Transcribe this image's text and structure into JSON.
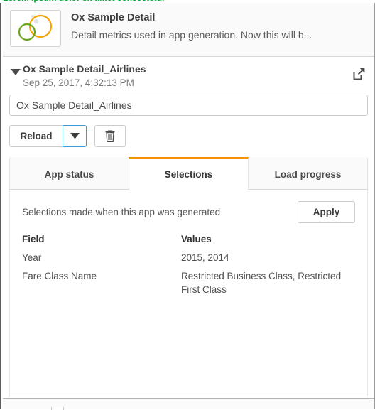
{
  "top_clipped_text": "Lorem ipsum dolor sit amet consectetur",
  "app_header": {
    "title": "Ox Sample Detail",
    "description": "Detail metrics used in app generation. Now this will b...",
    "thumbnail_icon": "two-overlapping-circles-icon",
    "colors": {
      "circle_green": "#6aa61b",
      "circle_orange": "#f5a300",
      "dot_gray": "#d9d9d9"
    }
  },
  "generated_app": {
    "caret_icon": "triangle-down-icon",
    "name": "Ox Sample Detail_Airlines",
    "timestamp": "Sep 25, 2017, 4:32:13 PM",
    "open_icon": "open-external-icon"
  },
  "name_field": {
    "value": "Ox Sample Detail_Airlines",
    "placeholder": "Ox Sample Detail_Airlines"
  },
  "actions": {
    "reload_label": "Reload",
    "reload_caret_icon": "caret-down-icon",
    "delete_icon": "trash-icon",
    "focus_color": "#3b9cd9"
  },
  "tabs": {
    "active_index": 1,
    "accent_color": "#f29400",
    "items": [
      {
        "label": "App status"
      },
      {
        "label": "Selections"
      },
      {
        "label": "Load progress"
      }
    ]
  },
  "selections_tab": {
    "note": "Selections made when this app was generated",
    "apply_label": "Apply",
    "columns": [
      "Field",
      "Values"
    ],
    "rows": [
      {
        "field": "Year",
        "values": "2015, 2014"
      },
      {
        "field": "Fare Class Name",
        "values": "Restricted Business Class, Restricted First Class"
      }
    ]
  }
}
